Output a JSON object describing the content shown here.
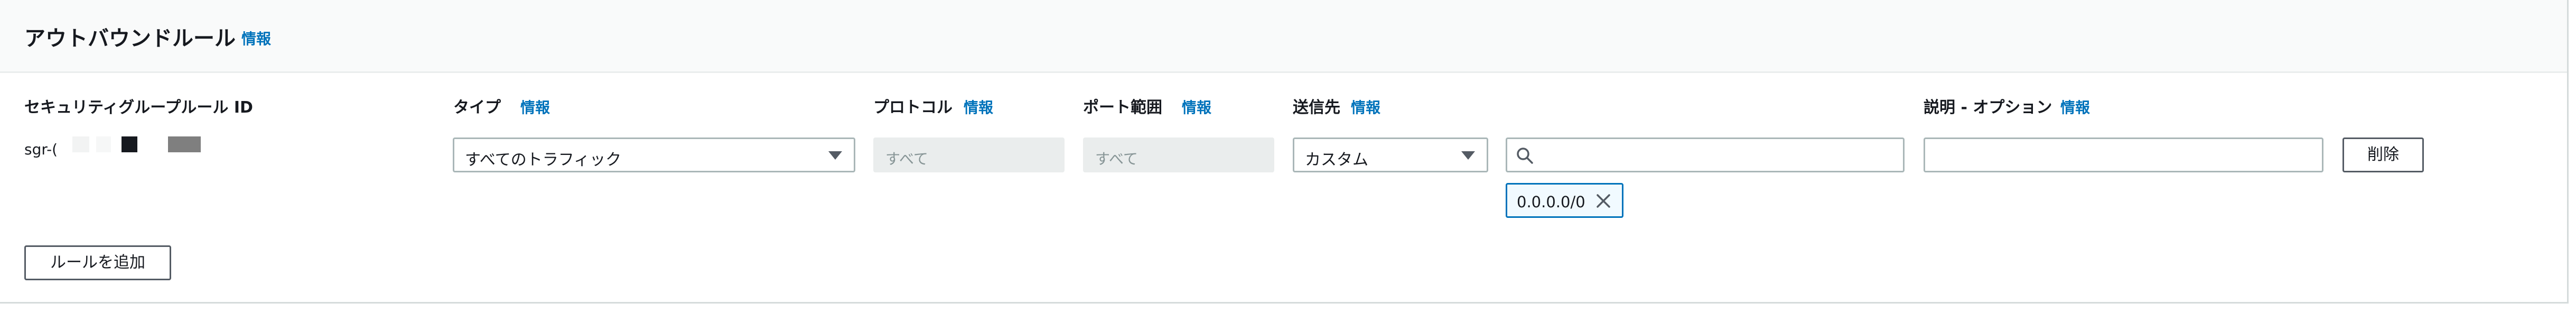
{
  "section": {
    "title": "アウトバウンドルール",
    "info_label": "情報"
  },
  "columns": {
    "rule_id": {
      "label": "セキュリティグループルール ID"
    },
    "type": {
      "label": "タイプ",
      "info_label": "情報"
    },
    "protocol": {
      "label": "プロトコル",
      "info_label": "情報"
    },
    "port_range": {
      "label": "ポート範囲",
      "info_label": "情報"
    },
    "destination": {
      "label": "送信先",
      "info_label": "情報"
    },
    "description": {
      "label": "説明 - オプション",
      "info_label": "情報"
    }
  },
  "rule": {
    "id": "sgr-(",
    "type_value": "すべてのトラフィック",
    "protocol_value": "すべて",
    "port_range_value": "すべて",
    "destination_type_value": "カスタム",
    "destination_search_value": "",
    "destination_token": "0.0.0.0/0",
    "description_value": "",
    "delete_label": "削除"
  },
  "actions": {
    "add_rule_label": "ルールを追加"
  },
  "icons": {
    "search": "search-icon",
    "dismiss_token": "close-icon",
    "dropdown": "caret-down-icon"
  },
  "colors": {
    "link": "#0073bb",
    "text": "#16191f",
    "border": "#aab7b8",
    "disabled_bg": "#eaeded",
    "token_bg": "#f1faff",
    "header_bg": "#f9fafa"
  }
}
